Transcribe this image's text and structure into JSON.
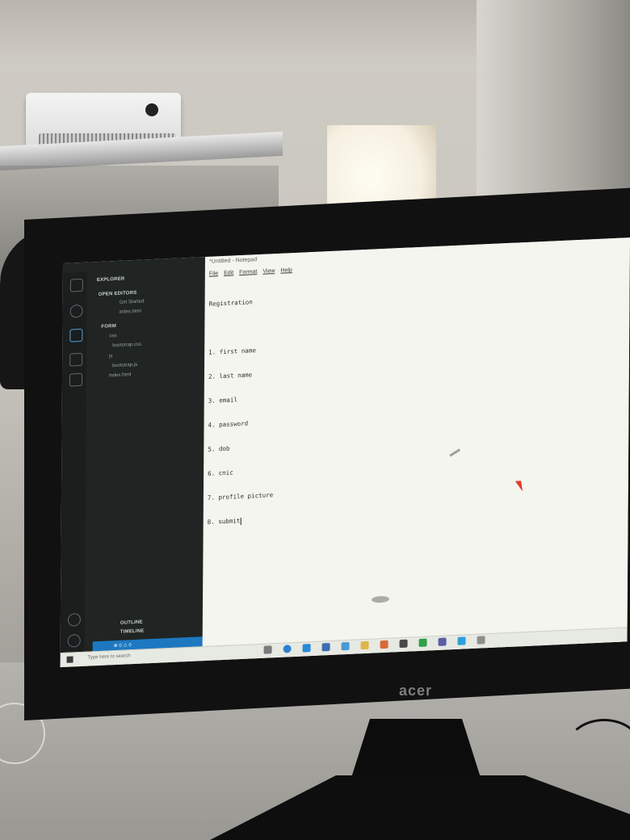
{
  "vscode": {
    "explorer_label": "EXPLORER",
    "open_editors_label": "OPEN EDITORS",
    "open_editors": [
      "Get Started",
      "index.html"
    ],
    "folder_label": "FORM",
    "tree": [
      "css",
      "bootstrap.css",
      "js",
      "bootstrap.js",
      "index.html"
    ],
    "outline_label": "OUTLINE",
    "timeline_label": "TIMELINE",
    "status_text": "⊗ 0 ⚠ 0"
  },
  "notepad": {
    "title": "*Untitled - Notepad",
    "menu": [
      "File",
      "Edit",
      "Format",
      "View",
      "Help"
    ],
    "lines": [
      "Registration",
      "",
      "1. first name",
      "2. last name",
      "3. email",
      "4. password",
      "5. dob",
      "6. cnic",
      "7. profile picture",
      "8. submit"
    ]
  },
  "taskbar": {
    "search_placeholder": "Type here to search"
  },
  "monitor": {
    "brand": "acer"
  },
  "colors": {
    "vscode_sidebar": "#202523",
    "status_bar": "#1d78c1",
    "notepad_bg": "#f3f5ee",
    "mouse_cursor": "#e43b2a"
  }
}
